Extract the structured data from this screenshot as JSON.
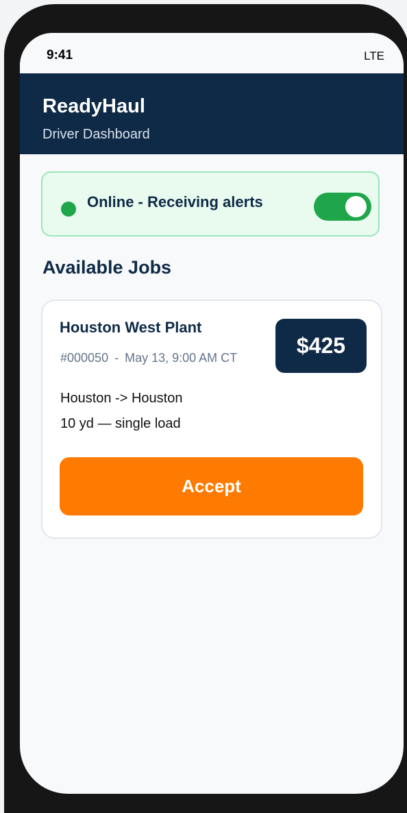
{
  "status_bar": {
    "time": "9:41",
    "network": "LTE"
  },
  "header": {
    "title": "ReadyHaul",
    "subtitle": "Driver Dashboard"
  },
  "availability": {
    "label": "Online - Receiving alerts",
    "toggle_on": true,
    "indicator_color": "#1fa64a"
  },
  "jobs_section": {
    "heading": "Available Jobs"
  },
  "jobs": [
    {
      "title": "Houston West Plant",
      "id": "#000050",
      "separator": "-",
      "schedule": "May 13, 9:00 AM CT",
      "route": "Houston -> Houston",
      "load": "10 yd — single load",
      "price": "$425",
      "accept_label": "Accept"
    }
  ],
  "colors": {
    "header_bg": "#0f2a47",
    "accent_orange": "#ff7a00",
    "online_green": "#1fa64a",
    "status_card_bg": "#e9fbef"
  }
}
